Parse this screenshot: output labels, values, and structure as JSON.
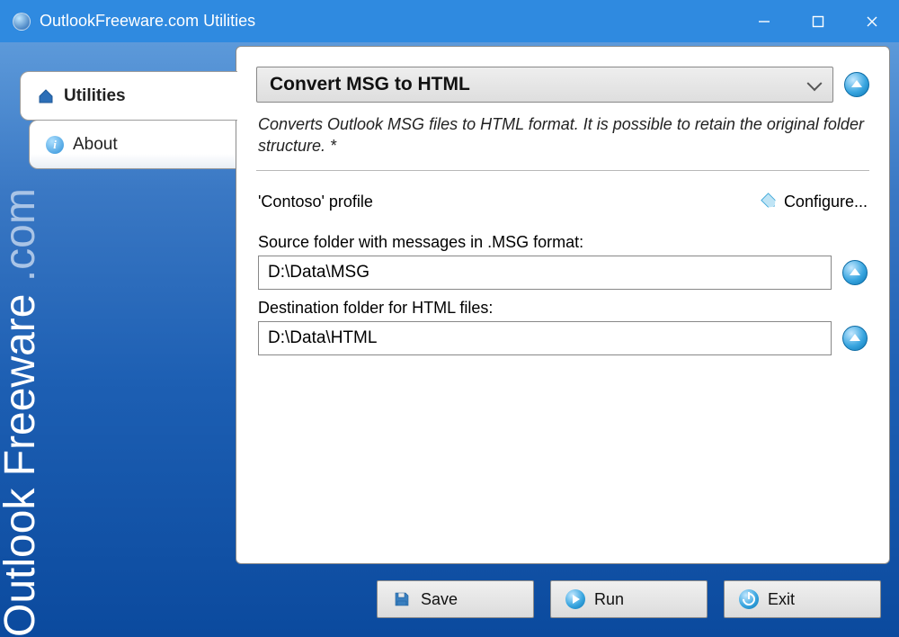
{
  "window": {
    "title": "OutlookFreeware.com Utilities"
  },
  "brand": {
    "main": "Outlook Freeware",
    "suffix": ".com"
  },
  "tabs": [
    {
      "label": "Utilities"
    },
    {
      "label": "About"
    }
  ],
  "utility": {
    "title": "Convert MSG to HTML",
    "description": "Converts Outlook MSG files to HTML format. It is possible to retain the original folder structure. *"
  },
  "profile": {
    "label": "'Contoso' profile",
    "configure": "Configure..."
  },
  "source": {
    "label": "Source folder with messages in .MSG format:",
    "value": "D:\\Data\\MSG"
  },
  "dest": {
    "label": "Destination folder for HTML files:",
    "value": "D:\\Data\\HTML"
  },
  "buttons": {
    "save": "Save",
    "run": "Run",
    "exit": "Exit"
  }
}
